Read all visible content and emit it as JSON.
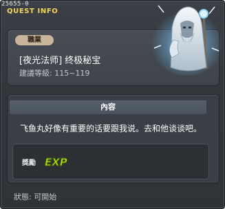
{
  "window": {
    "quest_id": "25655-0",
    "header_title": "QUEST INFO"
  },
  "info": {
    "job_badge": "職業",
    "quest_name": "[夜光法师] 终极秘宝",
    "level_range": "建議等級: 115~119"
  },
  "content": {
    "header": "內容",
    "text": "飞鱼丸好像有重要的话要跟我说。去和他谈谈吧。",
    "reward_label": "獎勵",
    "reward_icon_text": "EXP"
  },
  "status": {
    "label": "狀態: 可開始"
  },
  "colors": {
    "title_yellow": "#f2d75a",
    "badge_tan": "#c9b59b",
    "exp_green": "#b7e31c",
    "npc_glow": "#8fd6ff"
  },
  "icons": {
    "npc_portrait": "ghostly-mage-npc",
    "reward": "exp-icon"
  }
}
